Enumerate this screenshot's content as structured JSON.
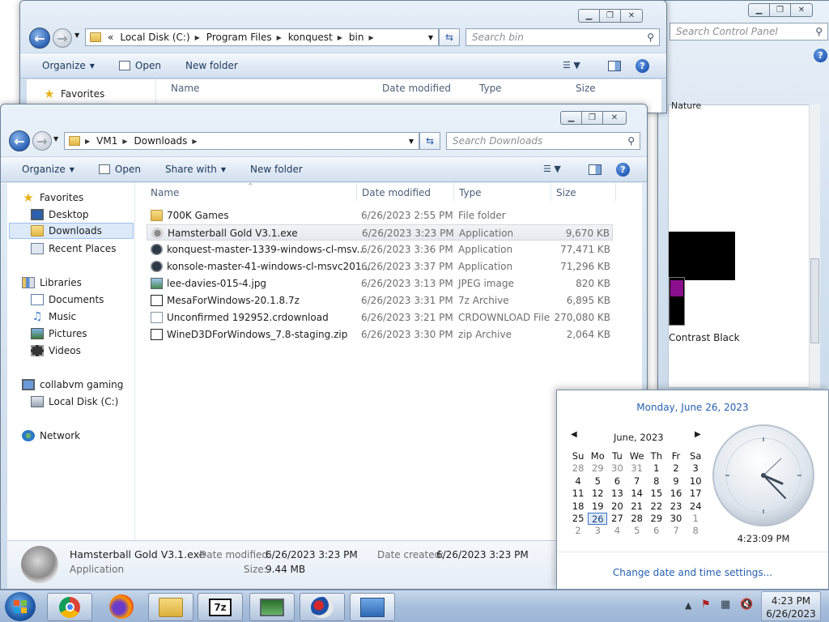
{
  "background_window": {
    "title_search_placeholder": "Search Control Panel",
    "help_icon": "help-icon",
    "partial_labels": [
      "Nature",
      "Contrast Black"
    ]
  },
  "explorer_back": {
    "address": [
      "Local Disk (C:)",
      "Program Files",
      "konquest",
      "bin"
    ],
    "address_prefix": "«",
    "search_placeholder": "Search bin",
    "toolbar": {
      "organize": "Organize",
      "open": "Open",
      "new_folder": "New folder"
    },
    "nav_favorites": "Favorites",
    "columns": {
      "name": "Name",
      "date": "Date modified",
      "type": "Type",
      "size": "Size"
    }
  },
  "explorer_front": {
    "address": [
      "VM1",
      "Downloads"
    ],
    "search_placeholder": "Search Downloads",
    "toolbar": {
      "organize": "Organize",
      "open": "Open",
      "share_with": "Share with",
      "new_folder": "New folder"
    },
    "nav": {
      "favorites": "Favorites",
      "desktop": "Desktop",
      "downloads": "Downloads",
      "recent_places": "Recent Places",
      "libraries": "Libraries",
      "documents": "Documents",
      "music": "Music",
      "pictures": "Pictures",
      "videos": "Videos",
      "computer": "collabvm gaming",
      "local_disk": "Local Disk (C:)",
      "network": "Network"
    },
    "columns": {
      "name": "Name",
      "date": "Date modified",
      "type": "Type",
      "size": "Size"
    },
    "files": [
      {
        "name": "700K Games",
        "date": "6/26/2023 2:55 PM",
        "type": "File folder",
        "size": "",
        "icon": "folder-icon"
      },
      {
        "name": "Hamsterball Gold V3.1.exe",
        "date": "6/26/2023 3:23 PM",
        "type": "Application",
        "size": "9,670 KB",
        "icon": "exe-icon"
      },
      {
        "name": "konquest-master-1339-windows-cl-msv...",
        "date": "6/26/2023 3:36 PM",
        "type": "Application",
        "size": "77,471 KB",
        "icon": "kde-icon"
      },
      {
        "name": "konsole-master-41-windows-cl-msvc201...",
        "date": "6/26/2023 3:37 PM",
        "type": "Application",
        "size": "71,296 KB",
        "icon": "kde-icon"
      },
      {
        "name": "lee-davies-015-4.jpg",
        "date": "6/26/2023 3:13 PM",
        "type": "JPEG image",
        "size": "820 KB",
        "icon": "jpeg-icon"
      },
      {
        "name": "MesaForWindows-20.1.8.7z",
        "date": "6/26/2023 3:31 PM",
        "type": "7z Archive",
        "size": "6,895 KB",
        "icon": "7z-icon"
      },
      {
        "name": "Unconfirmed 192952.crdownload",
        "date": "6/26/2023 3:21 PM",
        "type": "CRDOWNLOAD File",
        "size": "270,080 KB",
        "icon": "file-icon"
      },
      {
        "name": "WineD3DForWindows_7.8-staging.zip",
        "date": "6/26/2023 3:30 PM",
        "type": "zip Archive",
        "size": "2,064 KB",
        "icon": "7z-icon"
      }
    ],
    "details": {
      "name": "Hamsterball Gold V3.1.exe",
      "kind": "Application",
      "date_modified_label": "Date modified:",
      "date_modified": "6/26/2023 3:23 PM",
      "date_created_label": "Date created:",
      "date_created": "6/26/2023 3:23 PM",
      "size_label": "Size:",
      "size": "9.44 MB"
    }
  },
  "clock_flyout": {
    "long_date": "Monday, June 26, 2023",
    "month_label": "June, 2023",
    "weekdays": [
      "Su",
      "Mo",
      "Tu",
      "We",
      "Th",
      "Fr",
      "Sa"
    ],
    "weeks": [
      [
        "28",
        "29",
        "30",
        "31",
        "1",
        "2",
        "3"
      ],
      [
        "4",
        "5",
        "6",
        "7",
        "8",
        "9",
        "10"
      ],
      [
        "11",
        "12",
        "13",
        "14",
        "15",
        "16",
        "17"
      ],
      [
        "18",
        "19",
        "20",
        "21",
        "22",
        "23",
        "24"
      ],
      [
        "25",
        "26",
        "27",
        "28",
        "29",
        "30",
        "1"
      ],
      [
        "2",
        "3",
        "4",
        "5",
        "6",
        "7",
        "8"
      ]
    ],
    "today": "26",
    "time": "4:23:09 PM",
    "settings_link": "Change date and time settings..."
  },
  "taskbar": {
    "apps": [
      "chrome-icon",
      "firefox-icon",
      "explorer-icon",
      "7zip-icon",
      "monitor-app-icon",
      "paint-app-icon",
      "control-panel-icon"
    ],
    "time": "4:23 PM",
    "date": "6/26/2023"
  }
}
